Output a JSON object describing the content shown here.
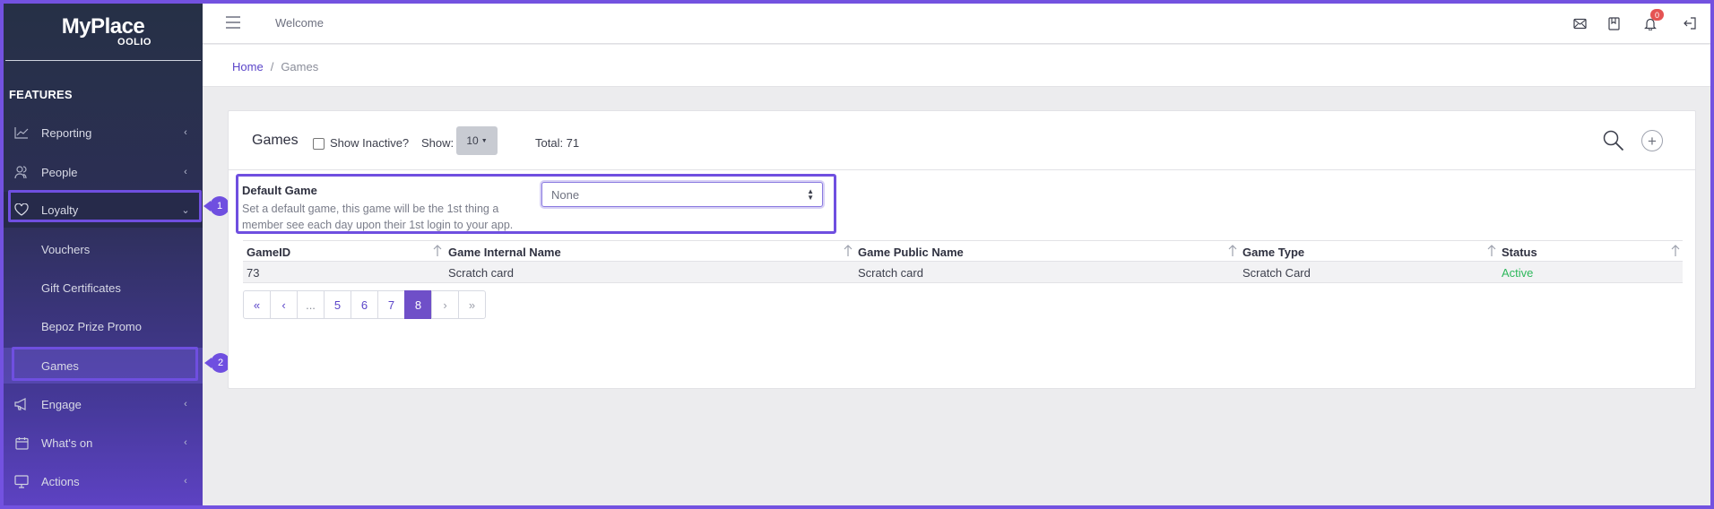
{
  "app": {
    "logo_main": "MyPlace",
    "logo_sub": "OOLIO"
  },
  "sidebar": {
    "section_title": "FEATURES",
    "items": [
      {
        "label": "Reporting",
        "icon": "chart-line-icon"
      },
      {
        "label": "People",
        "icon": "people-icon"
      },
      {
        "label": "Loyalty",
        "icon": "heart-icon"
      },
      {
        "label": "Vouchers"
      },
      {
        "label": "Gift Certificates"
      },
      {
        "label": "Bepoz Prize Promo"
      },
      {
        "label": "Games"
      },
      {
        "label": "Engage",
        "icon": "megaphone-icon"
      },
      {
        "label": "What's on",
        "icon": "calendar-icon"
      },
      {
        "label": "Actions",
        "icon": "monitor-icon"
      }
    ],
    "badges": [
      "1",
      "2"
    ]
  },
  "topbar": {
    "welcome": "Welcome",
    "notification_count": "0"
  },
  "breadcrumb": {
    "home": "Home",
    "separator": "/",
    "current": "Games"
  },
  "games": {
    "title": "Games",
    "show_inactive_label": "Show Inactive?",
    "show_label": "Show:",
    "show_value": "10",
    "total_text": "Total: 71",
    "default_game": {
      "title": "Default Game",
      "help": "Set a default game, this game will be the 1st thing a member see each day upon their 1st login to your app.",
      "selected": "None"
    },
    "table": {
      "headers": [
        "GameID",
        "Game Internal Name",
        "Game Public Name",
        "Game Type",
        "Status"
      ],
      "rows": [
        [
          "73",
          "Scratch card",
          "Scratch card",
          "Scratch Card",
          "Active"
        ]
      ]
    },
    "pagination": [
      "«",
      "‹",
      "...",
      "5",
      "6",
      "7",
      "8",
      "›",
      "»"
    ],
    "current_page": "8"
  },
  "colors": {
    "accent": "#6f4fe0",
    "active_status": "#2eb85c",
    "notification": "#e55353"
  }
}
